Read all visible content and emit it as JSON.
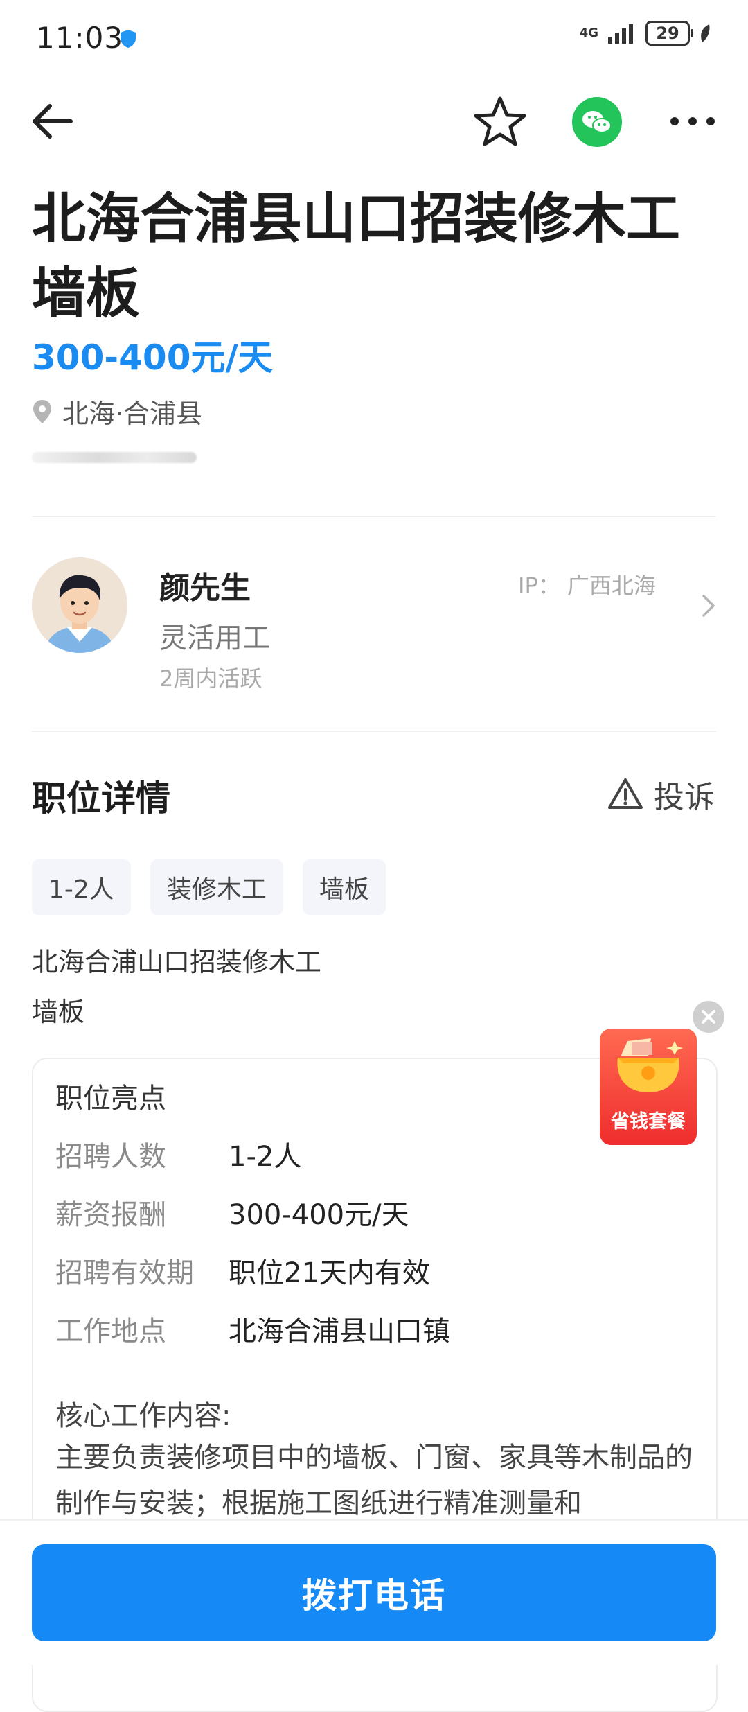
{
  "status_bar": {
    "time": "11:03",
    "network": "4G",
    "battery": "29"
  },
  "header": {
    "title": "北海合浦县山口招装修木工墙板",
    "salary": "300-400元/天",
    "location": "北海·合浦县"
  },
  "employer": {
    "name": "颜先生",
    "type": "灵活用工",
    "activity": "2周内活跃",
    "ip": "IP：  广西北海"
  },
  "details": {
    "section_title": "职位详情",
    "report_label": "投诉",
    "tags": [
      "1-2人",
      "装修木工",
      "墙板"
    ],
    "description_lines": [
      "北海合浦山口招装修木工",
      "墙板"
    ]
  },
  "highlights": {
    "title": "职位亮点",
    "rows": [
      {
        "label": "招聘人数",
        "value": "1-2人"
      },
      {
        "label": "薪资报酬",
        "value": "300-400元/天"
      },
      {
        "label": "招聘有效期",
        "value": "职位21天内有效"
      },
      {
        "label": "工作地点",
        "value": "北海合浦县山口镇"
      }
    ],
    "core_title": "核心工作内容:",
    "core_text": "主要负责装修项目中的墙板、门窗、家具等木制品的制作与安装；根据施工图纸进行精准测量和"
  },
  "promo": {
    "label": "省钱套餐"
  },
  "action": {
    "call_label": "拨打电话"
  },
  "colors": {
    "accent": "#1589f5",
    "salary": "#1a8bf0",
    "wechat": "#23c45a",
    "promo": "#ef2d2d"
  }
}
